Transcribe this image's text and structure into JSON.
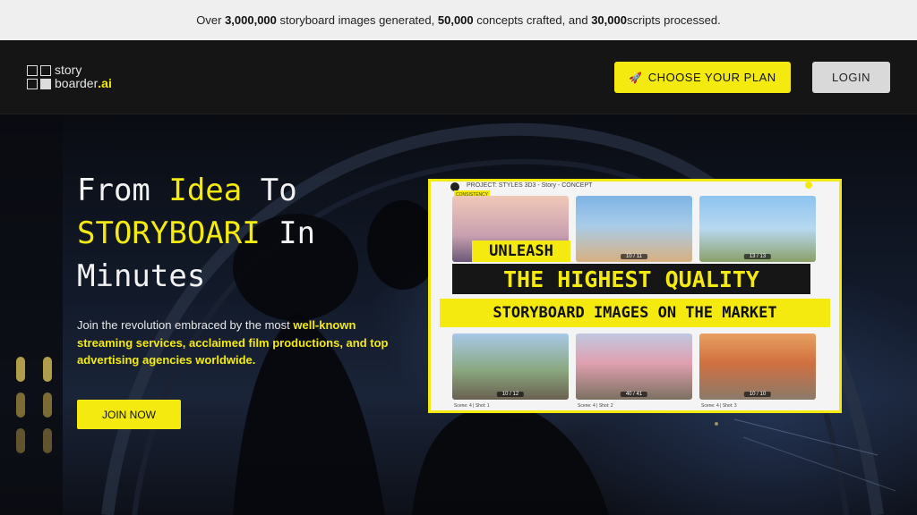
{
  "announcement": {
    "prefix": "Over ",
    "images_count": "3,000,000",
    "images_text": " storyboard images generated, ",
    "concepts_count": "50,000",
    "concepts_text": " concepts crafted, and ",
    "scripts_count": "30,000",
    "scripts_text": " scripts processed."
  },
  "nav": {
    "logo_line1": "story",
    "logo_line2": "boarder",
    "logo_ai": ".ai",
    "plan_button": "CHOOSE YOUR PLAN",
    "login_button": "LOGIN"
  },
  "hero": {
    "title_1": "From ",
    "title_hl_1": "Idea",
    "title_2": " To",
    "title_hl_2": "STORYBOARI",
    "title_3": " In",
    "title_4": "Minutes",
    "desc_1": "Join the revolution embraced by the most ",
    "desc_hl": "well-known streaming services, acclaimed film productions, and top advertising agencies worldwide.",
    "join_button": "JOIN NOW"
  },
  "promo": {
    "project_title": "PROJECT: STYLES 3D3 - Story - CONCEPT",
    "tag": "CONSISTENCY",
    "line_1": "UNLEASH",
    "line_2": "THE HIGHEST QUALITY",
    "line_3": "STORYBOARD IMAGES ON THE MARKET",
    "top_counters": [
      "10 / 11",
      "13 / 13"
    ],
    "bottom_counters": [
      "10 / 12",
      "40 / 41",
      "10 / 10"
    ],
    "scenes": [
      "Scene: 4 | Shot: 1",
      "Scene: 4 | Shot: 2",
      "Scene: 4 | Shot: 3"
    ]
  },
  "colors": {
    "accent": "#f4ea10",
    "nav_bg": "#151515",
    "banner_bg": "#efefef"
  }
}
